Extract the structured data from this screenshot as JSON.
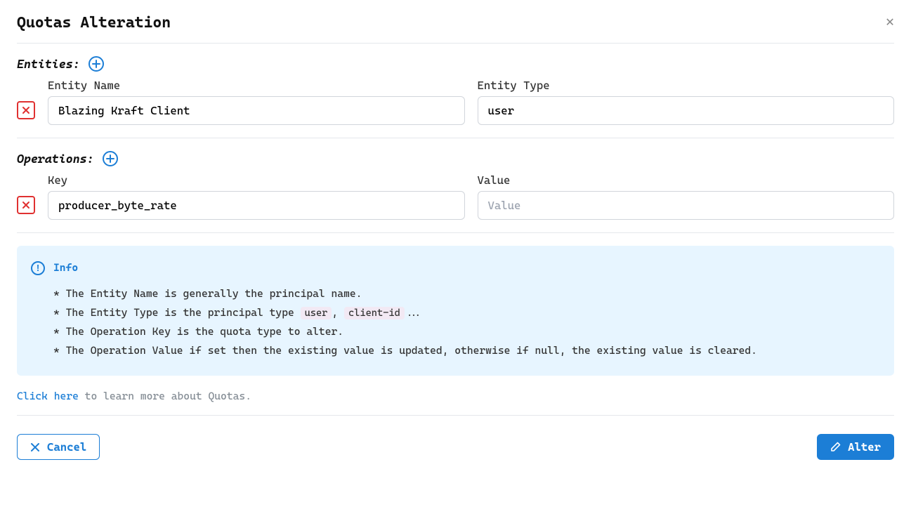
{
  "title": "Quotas Alteration",
  "entities": {
    "label": "Entities:",
    "name_label": "Entity Name",
    "type_label": "Entity Type",
    "rows": [
      {
        "name": "Blazing Kraft Client",
        "type": "user"
      }
    ]
  },
  "operations": {
    "label": "Operations:",
    "key_label": "Key",
    "value_label": "Value",
    "value_placeholder": "Value",
    "rows": [
      {
        "key": "producer_byte_rate",
        "value": ""
      }
    ]
  },
  "info": {
    "title": "Info",
    "lines": [
      "* The Entity Name is generally the principal name.",
      "* The Entity Type is the principal type ",
      "* The Operation Key is the quota type to alter.",
      "* The Operation Value if set then the existing value is updated, otherwise if null, the existing value is cleared."
    ],
    "pill1": "user",
    "pill2": "client-id",
    "comma": ",",
    "dots": "..."
  },
  "learn": {
    "link": "Click here",
    "rest": " to learn more about Quotas."
  },
  "buttons": {
    "cancel": "Cancel",
    "alter": "Alter"
  }
}
